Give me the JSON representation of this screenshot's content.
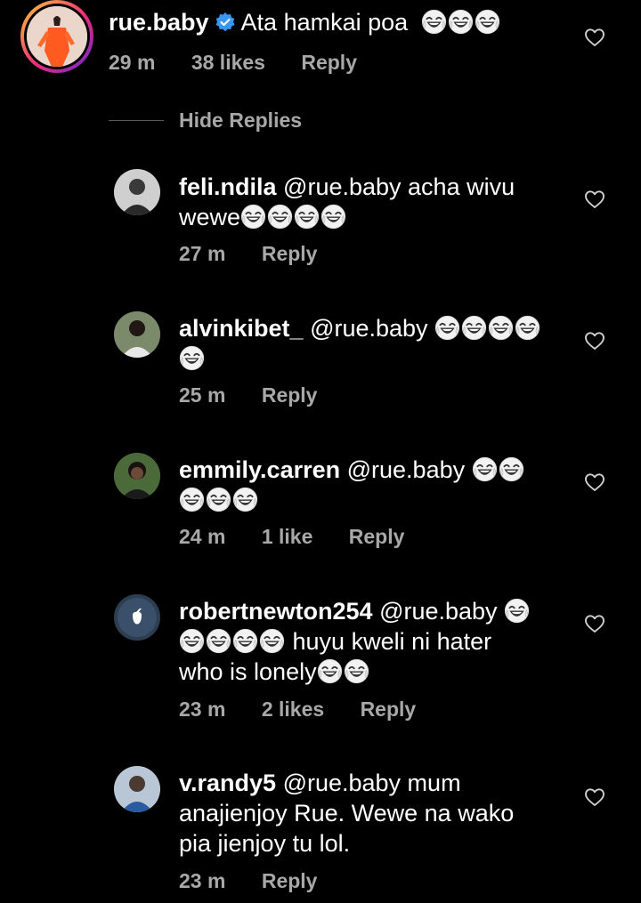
{
  "main_comment": {
    "username": "rue.baby",
    "verified_icon": "verified-badge-icon",
    "text": "Ata hamkai poa",
    "emoji": "tears-of-joy-emoji",
    "emoji_count": 3,
    "time": "29 m",
    "likes": "38 likes",
    "reply": "Reply"
  },
  "hide_replies": "Hide Replies",
  "replies": [
    {
      "username": "feli.ndila",
      "line1": "@rue.baby acha wivu",
      "line2": "wewe",
      "emoji_count_line2": 4,
      "time": "27 m",
      "likes": "",
      "reply": "Reply"
    },
    {
      "username": "alvinkibet_",
      "line1": "@rue.baby",
      "emoji_count_line1": 4,
      "emoji_count_line2": 1,
      "time": "25 m",
      "likes": "",
      "reply": "Reply"
    },
    {
      "username": "emmily.carren",
      "line1": "@rue.baby",
      "emoji_count_line1": 2,
      "emoji_count_line2": 3,
      "time": "24 m",
      "likes": "1 like",
      "reply": "Reply"
    },
    {
      "username": "robertnewton254",
      "line1": "@rue.baby",
      "line2": "huyu kweli ni hater",
      "line3": "who is lonely",
      "emoji_count_line1": 1,
      "emoji_count_line2": 4,
      "emoji_count_line3": 2,
      "time": "23 m",
      "likes": "2 likes",
      "reply": "Reply"
    },
    {
      "username": "v.randy5",
      "line1": "@rue.baby mum",
      "line2": "anajienjoy Rue. Wewe na wako",
      "line3": "pia jienjoy tu lol.",
      "time": "23 m",
      "likes": "",
      "reply": "Reply"
    }
  ],
  "icons": {
    "like": "heart-outline-icon",
    "avatar": "profile-avatar"
  }
}
